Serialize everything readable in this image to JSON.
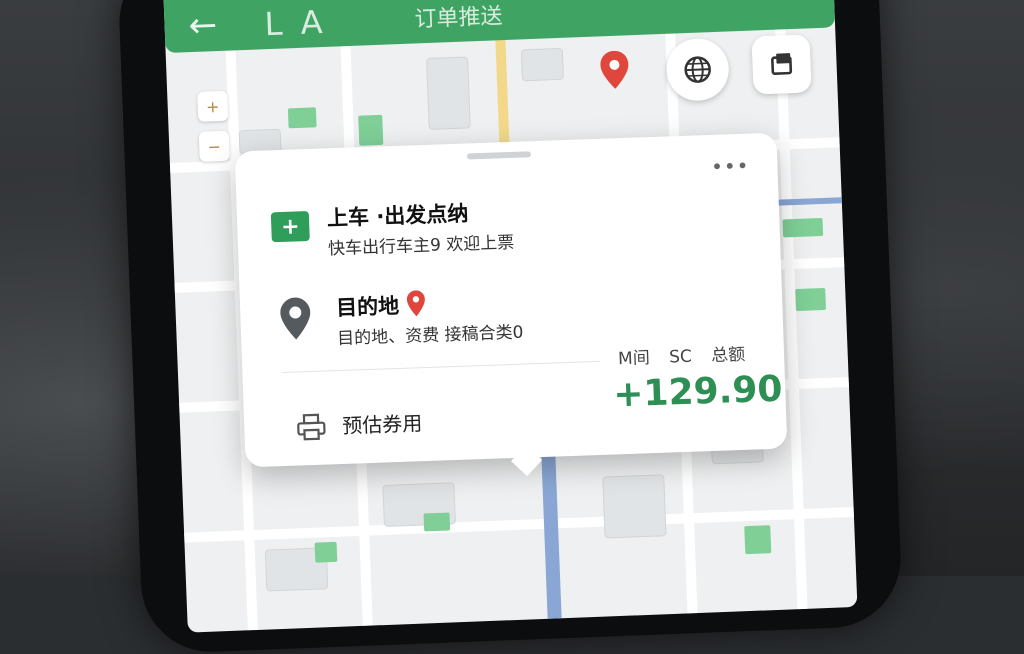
{
  "header": {
    "back_icon": "←",
    "left_chars": "L A",
    "title": "订单推送"
  },
  "map_controls": {
    "globe_icon": "globe-icon",
    "layers_icon": "layers-icon",
    "zoom_in": "+",
    "zoom_out": "−"
  },
  "card": {
    "more": "•••",
    "pickup": {
      "title": "上车 ·出发点纳",
      "subtitle": "快车出行车主9 欢迎上票"
    },
    "destination": {
      "title": "目的地",
      "subtitle": "目的地、资费 接稿合类0"
    },
    "columns": [
      "M间",
      "SC",
      "总额"
    ],
    "fare": {
      "label": "预估券用",
      "price": "+129.90"
    }
  },
  "colors": {
    "brand_green": "#3fa463",
    "price_green": "#2e8f54",
    "pin_red": "#e0463c"
  }
}
